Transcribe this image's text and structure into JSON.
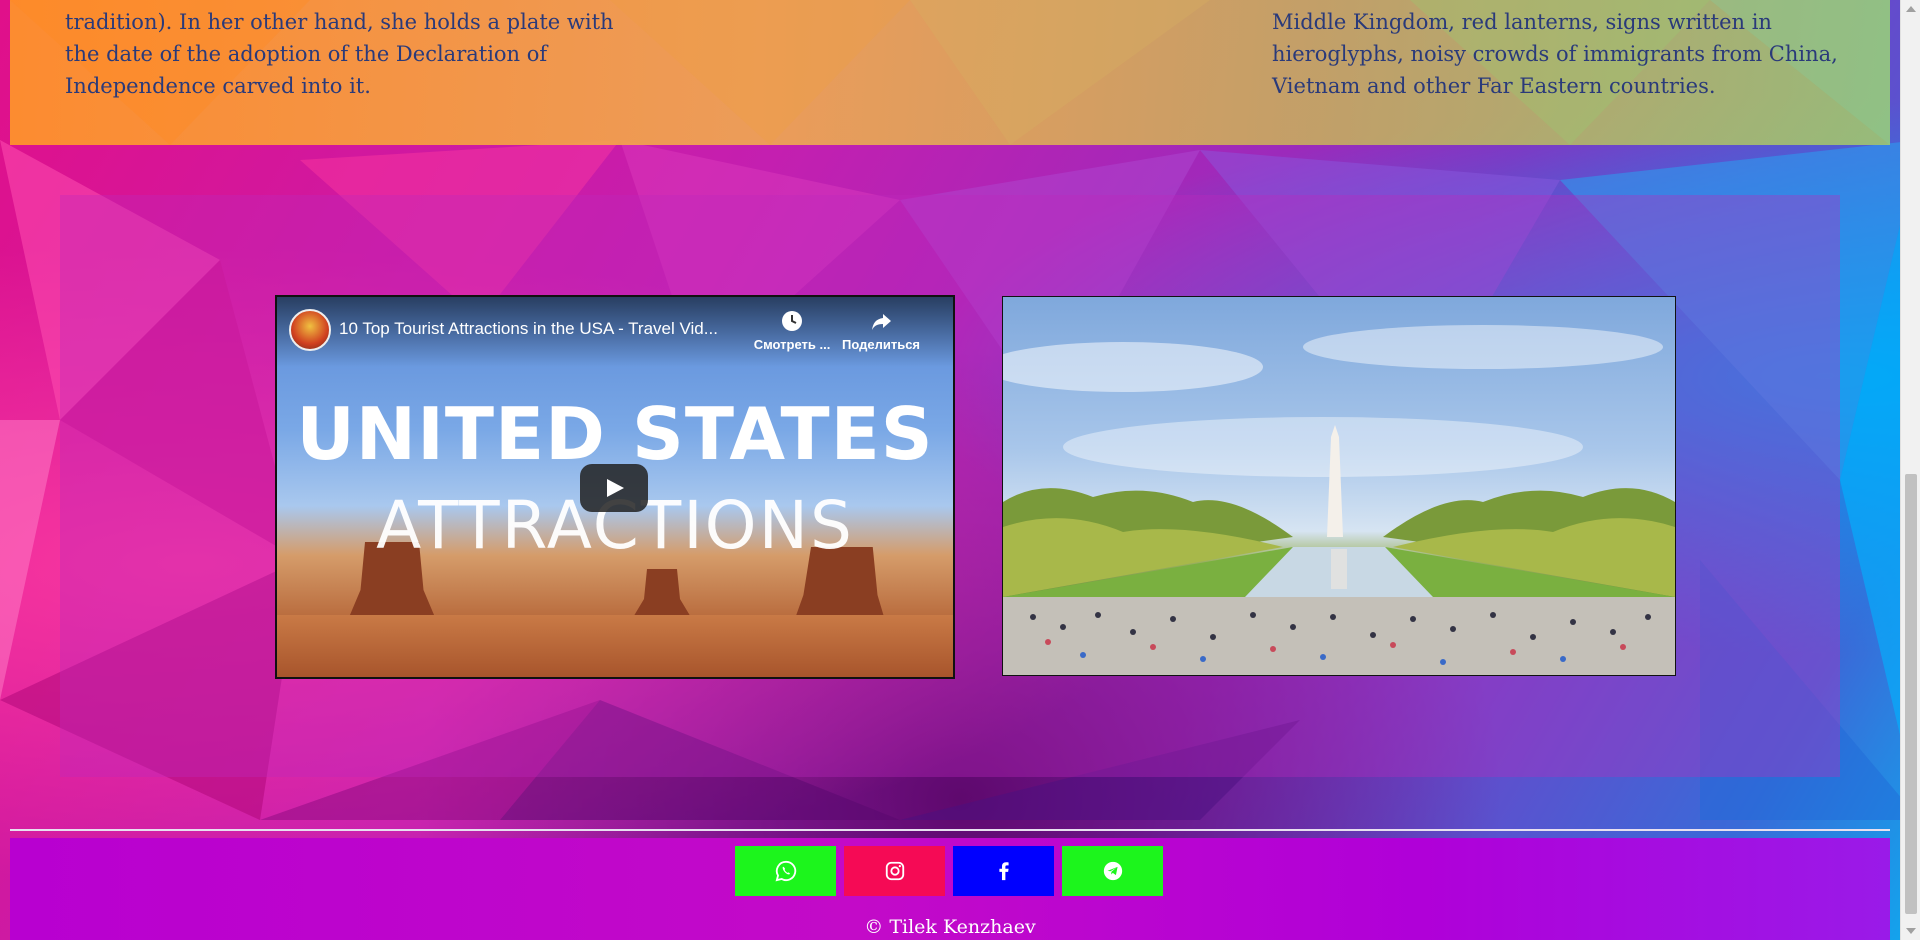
{
  "article": {
    "left_text": "tradition). In her other hand, she holds a plate with the date of the adoption of the Declaration of Independence carved into it.",
    "right_text": "Middle Kingdom, red lanterns, signs written in hieroglyphs, noisy crowds of immigrants from China, Vietnam and other Far Eastern countries."
  },
  "video": {
    "title": "10 Top Tourist Attractions in the USA - Travel Vid...",
    "watch_later_label": "Смотреть ...",
    "share_label": "Поделиться",
    "thumbnail_line1": "UNITED STATES",
    "thumbnail_line2": "ATTRACTIONS",
    "icons": {
      "channel": "channel-avatar-icon",
      "watch_later": "clock-icon",
      "share": "share-arrow-icon",
      "play": "play-icon"
    }
  },
  "photo": {
    "subject": "Washington Monument and Reflecting Pool"
  },
  "footer": {
    "social": [
      {
        "name": "whatsapp",
        "icon": "whatsapp-icon",
        "color": "#1cf51c"
      },
      {
        "name": "instagram",
        "icon": "instagram-icon",
        "color": "#f50a55"
      },
      {
        "name": "facebook",
        "icon": "facebook-icon",
        "color": "#0000ff"
      },
      {
        "name": "telegram",
        "icon": "telegram-icon",
        "color": "#1cf51c"
      }
    ],
    "copyright": "© Tilek Kenzhaev"
  },
  "colors": {
    "article_text": "#2a3a7a",
    "footer_bg": "#c30ac8"
  }
}
